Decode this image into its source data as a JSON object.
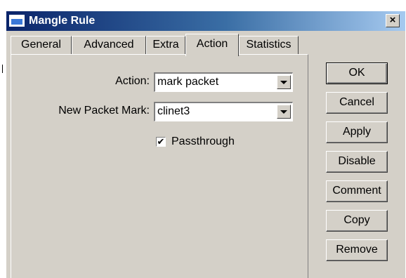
{
  "window": {
    "title": "Mangle Rule",
    "close_glyph": "×"
  },
  "tabs": [
    {
      "label": "General",
      "active": false
    },
    {
      "label": "Advanced",
      "active": false
    },
    {
      "label": "Extra",
      "active": false
    },
    {
      "label": "Action",
      "active": true
    },
    {
      "label": "Statistics",
      "active": false
    }
  ],
  "form": {
    "action_label": "Action:",
    "action_value": "mark packet",
    "new_packet_mark_label": "New Packet Mark:",
    "new_packet_mark_value": "clinet3",
    "passthrough_label": "Passthrough",
    "passthrough_checked": true,
    "check_glyph": "✔"
  },
  "buttons": {
    "ok": "OK",
    "cancel": "Cancel",
    "apply": "Apply",
    "disable": "Disable",
    "comment": "Comment",
    "copy": "Copy",
    "remove": "Remove"
  },
  "colors": {
    "titlebar_start": "#0a246a",
    "titlebar_end": "#a6caf0",
    "window_bg": "#d4d0c8"
  },
  "icons": {
    "title": "window-icon",
    "close": "close-icon",
    "dropdown": "chevron-down-icon",
    "checkbox": "checkmark-icon"
  }
}
